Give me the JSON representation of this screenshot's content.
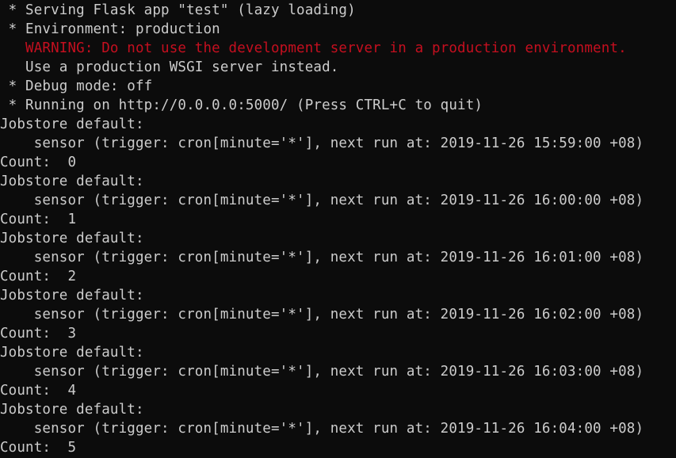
{
  "terminal": {
    "colors": {
      "background": "#0c0c0c",
      "foreground": "#cccccc",
      "warning": "#c50f1f"
    },
    "lines": [
      {
        "text": " * Serving Flask app \"test\" (lazy loading)",
        "kind": "normal"
      },
      {
        "text": " * Environment: production",
        "kind": "normal"
      },
      {
        "text": "   WARNING: Do not use the development server in a production environment.",
        "kind": "warning"
      },
      {
        "text": "   Use a production WSGI server instead.",
        "kind": "normal"
      },
      {
        "text": " * Debug mode: off",
        "kind": "normal"
      },
      {
        "text": " * Running on http://0.0.0.0:5000/ (Press CTRL+C to quit)",
        "kind": "normal"
      },
      {
        "text": "Jobstore default:",
        "kind": "normal"
      },
      {
        "text": "    sensor (trigger: cron[minute='*'], next run at: 2019-11-26 15:59:00 +08)",
        "kind": "normal"
      },
      {
        "text": "Count:  0",
        "kind": "normal"
      },
      {
        "text": "Jobstore default:",
        "kind": "normal"
      },
      {
        "text": "    sensor (trigger: cron[minute='*'], next run at: 2019-11-26 16:00:00 +08)",
        "kind": "normal"
      },
      {
        "text": "Count:  1",
        "kind": "normal"
      },
      {
        "text": "Jobstore default:",
        "kind": "normal"
      },
      {
        "text": "    sensor (trigger: cron[minute='*'], next run at: 2019-11-26 16:01:00 +08)",
        "kind": "normal"
      },
      {
        "text": "Count:  2",
        "kind": "normal"
      },
      {
        "text": "Jobstore default:",
        "kind": "normal"
      },
      {
        "text": "    sensor (trigger: cron[minute='*'], next run at: 2019-11-26 16:02:00 +08)",
        "kind": "normal"
      },
      {
        "text": "Count:  3",
        "kind": "normal"
      },
      {
        "text": "Jobstore default:",
        "kind": "normal"
      },
      {
        "text": "    sensor (trigger: cron[minute='*'], next run at: 2019-11-26 16:03:00 +08)",
        "kind": "normal"
      },
      {
        "text": "Count:  4",
        "kind": "normal"
      },
      {
        "text": "Jobstore default:",
        "kind": "normal"
      },
      {
        "text": "    sensor (trigger: cron[minute='*'], next run at: 2019-11-26 16:04:00 +08)",
        "kind": "normal"
      },
      {
        "text": "Count:  5",
        "kind": "normal"
      }
    ]
  }
}
